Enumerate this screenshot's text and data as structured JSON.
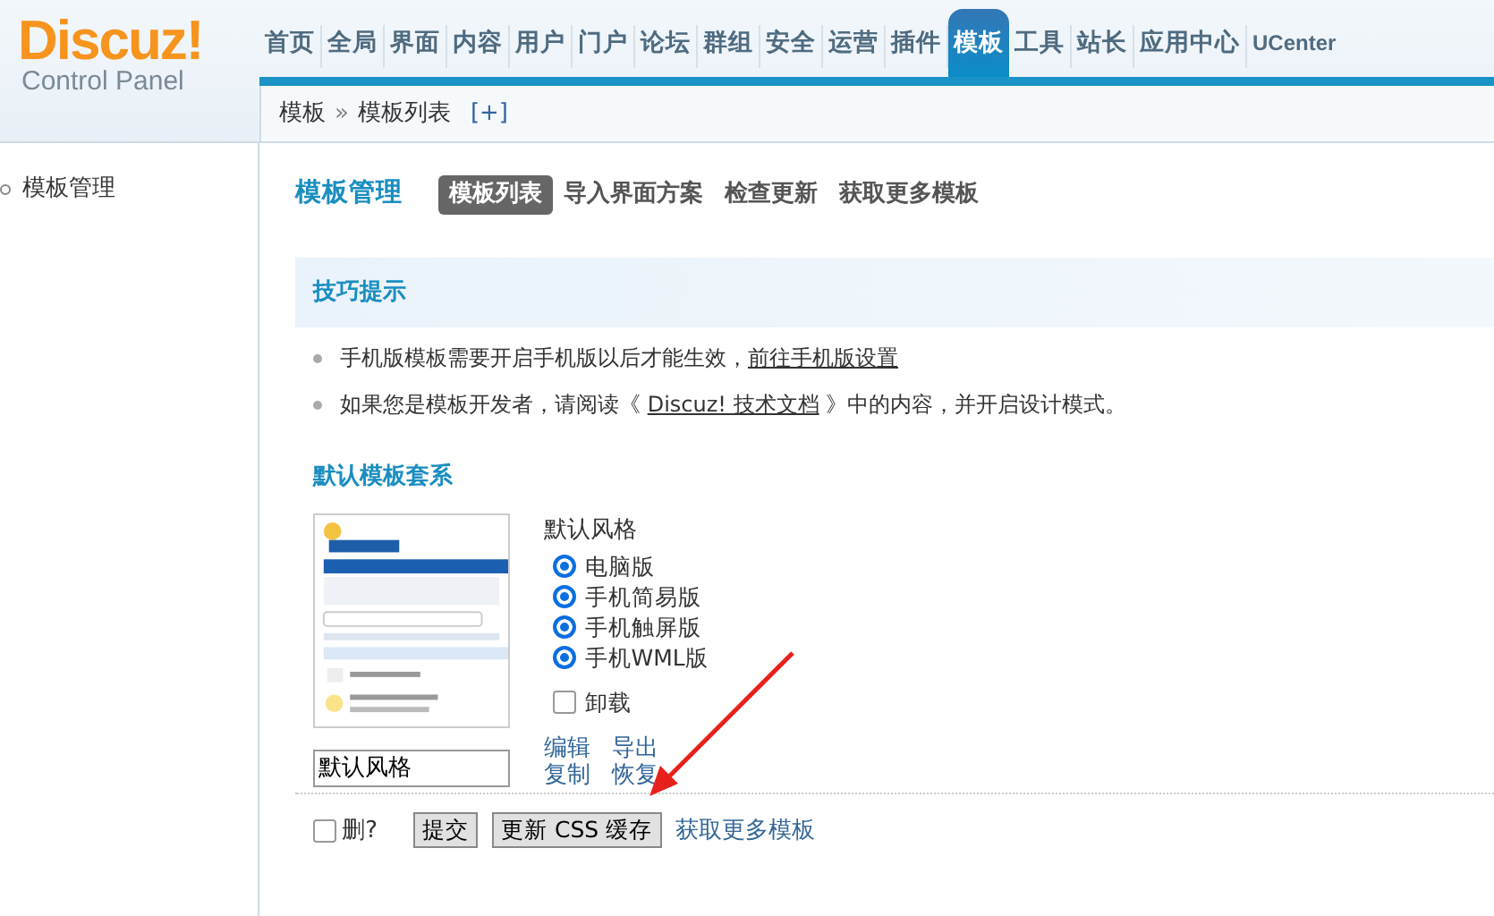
{
  "logo": {
    "title": "Discuz!",
    "subtitle": "Control Panel"
  },
  "nav": [
    {
      "label": "首页",
      "selected": false
    },
    {
      "label": "全局",
      "selected": false
    },
    {
      "label": "界面",
      "selected": false
    },
    {
      "label": "内容",
      "selected": false
    },
    {
      "label": "用户",
      "selected": false
    },
    {
      "label": "门户",
      "selected": false
    },
    {
      "label": "论坛",
      "selected": false
    },
    {
      "label": "群组",
      "selected": false
    },
    {
      "label": "安全",
      "selected": false
    },
    {
      "label": "运营",
      "selected": false
    },
    {
      "label": "插件",
      "selected": false
    },
    {
      "label": "模板",
      "selected": true
    },
    {
      "label": "工具",
      "selected": false
    },
    {
      "label": "站长",
      "selected": false
    },
    {
      "label": "应用中心",
      "selected": false
    },
    {
      "label": "UCenter",
      "selected": false
    }
  ],
  "breadcrumb": {
    "items": [
      "模板",
      "模板列表"
    ],
    "separator": "»",
    "add": "[+]"
  },
  "sidebar": {
    "items": [
      {
        "label": "模板管理"
      }
    ]
  },
  "page": {
    "title": "模板管理",
    "tabs": [
      {
        "label": "模板列表",
        "selected": true
      },
      {
        "label": "导入界面方案",
        "selected": false
      },
      {
        "label": "检查更新",
        "selected": false
      },
      {
        "label": "获取更多模板",
        "selected": false
      }
    ]
  },
  "tips": {
    "title": "技巧提示",
    "items": [
      {
        "before": "手机版模板需要开启手机版以后才能生效，",
        "link": "前往手机版设置"
      },
      {
        "before": "如果您是模板开发者，请阅读《 ",
        "link": "Discuz! 技术文档",
        "after": " 》中的内容，并开启设计模式。"
      }
    ]
  },
  "section_title": "默认模板套系",
  "template": {
    "name_value": "默认风格",
    "style_label": "默认风格",
    "styles": [
      {
        "label": "电脑版",
        "checked": true
      },
      {
        "label": "手机简易版",
        "checked": true
      },
      {
        "label": "手机触屏版",
        "checked": true
      },
      {
        "label": "手机WML版",
        "checked": true
      }
    ],
    "uninstall": {
      "label": "卸载",
      "checked": false
    },
    "actions": [
      "编辑",
      "导出",
      "复制",
      "恢复"
    ]
  },
  "footer": {
    "delete": {
      "label": "删?",
      "checked": false
    },
    "buttons": [
      "提交",
      "更新 CSS 缓存"
    ],
    "link": "获取更多模板"
  }
}
